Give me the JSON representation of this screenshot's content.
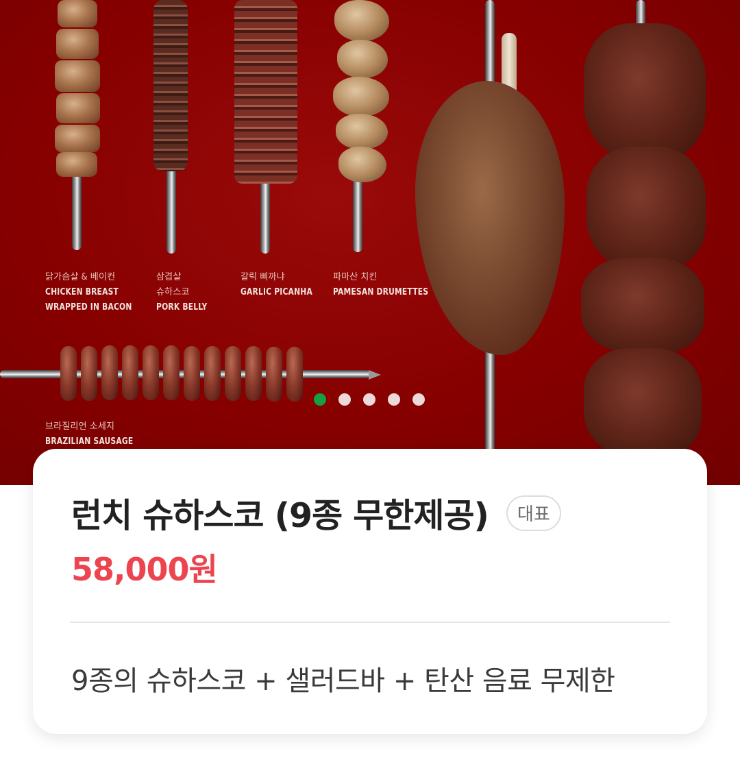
{
  "hero": {
    "captions": [
      {
        "kr": "닭가슴살 & 베이컨",
        "en1": "CHICKEN BREAST",
        "en2": "WRAPPED IN BACON"
      },
      {
        "kr": "삼겹살",
        "kr2": "슈하스코",
        "en1": "PORK BELLY"
      },
      {
        "kr": "갈릭 삐까냐",
        "en1": "GARLIC PICANHA"
      },
      {
        "kr": "파마산 치킨",
        "en1": "PAMESAN DRUMETTES"
      },
      {
        "kr": "브라질리언 소세지",
        "en1": "BRAZILIAN SAUSAGE"
      }
    ],
    "background_color": "#860000",
    "pager": {
      "count": 5,
      "active_index": 0,
      "active_color": "#15a046"
    }
  },
  "menu": {
    "title": "런치 슈하스코 (9종 무한제공)",
    "badge": "대표",
    "price": "58,000원",
    "price_color": "#ec4550",
    "description": "9종의 슈하스코 + 샐러드바 + 탄산 음료 무제한"
  }
}
